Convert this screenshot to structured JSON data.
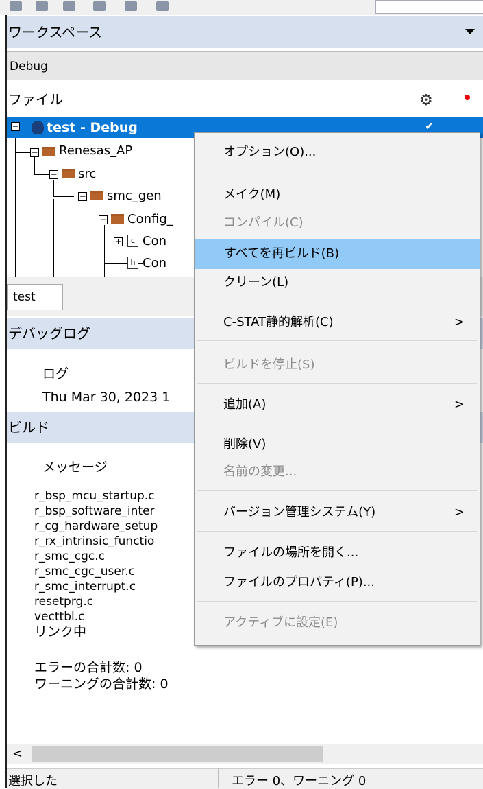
{
  "workspace": {
    "title": "ワークスペース",
    "config": "Debug",
    "column_file": "ファイル",
    "project": "test - Debug",
    "checkmark": "✔",
    "tree": [
      {
        "label": "Renesas_AP"
      },
      {
        "label": "src"
      },
      {
        "label": "smc_gen"
      },
      {
        "label": "Config_"
      },
      {
        "label": "Con",
        "icon": "c"
      },
      {
        "label": "Con",
        "icon": "h"
      }
    ],
    "tab": "test"
  },
  "debug_log": {
    "title": "デバッグログ",
    "column": "ログ",
    "entry": "Thu Mar 30, 2023 1"
  },
  "build": {
    "title": "ビルド",
    "column": "メッセージ",
    "messages": [
      "r_bsp_mcu_startup.c",
      "r_bsp_software_inter",
      "r_cg_hardware_setup",
      "r_rx_intrinsic_functio",
      "r_smc_cgc.c",
      "r_smc_cgc_user.c",
      "r_smc_interrupt.c",
      "resetprg.c",
      "vecttbl.c",
      "リンク中"
    ],
    "errors": "エラーの合計数: 0",
    "warnings": "ワーニングの合計数: 0"
  },
  "statusbar": {
    "left": "選択した",
    "right": "エラー 0、ワーニング 0"
  },
  "context_menu": {
    "items": [
      {
        "label": "オプション(O)...",
        "disabled": false
      },
      {
        "label": "メイク(M)",
        "disabled": false
      },
      {
        "label": "コンパイル(C)",
        "disabled": true
      },
      {
        "label": "すべてを再ビルド(B)",
        "disabled": false,
        "highlighted": true
      },
      {
        "label": "クリーン(L)",
        "disabled": false
      },
      {
        "label": "C-STAT静的解析(C)",
        "disabled": false,
        "submenu": true
      },
      {
        "label": "ビルドを停止(S)",
        "disabled": true
      },
      {
        "label": "追加(A)",
        "disabled": false,
        "submenu": true
      },
      {
        "label": "削除(V)",
        "disabled": false
      },
      {
        "label": "名前の変更...",
        "disabled": true
      },
      {
        "label": "バージョン管理システム(Y)",
        "disabled": false,
        "submenu": true
      },
      {
        "label": "ファイルの場所を開く...",
        "disabled": false
      },
      {
        "label": "ファイルのプロパティ(P)...",
        "disabled": false
      },
      {
        "label": "アクティブに設定(E)",
        "disabled": true
      }
    ],
    "submenu_arrow": ">"
  },
  "colors": {
    "accent": "#0a78d7",
    "menu_highlight": "#91c9f7",
    "pane_header": "#d6e0ee"
  }
}
